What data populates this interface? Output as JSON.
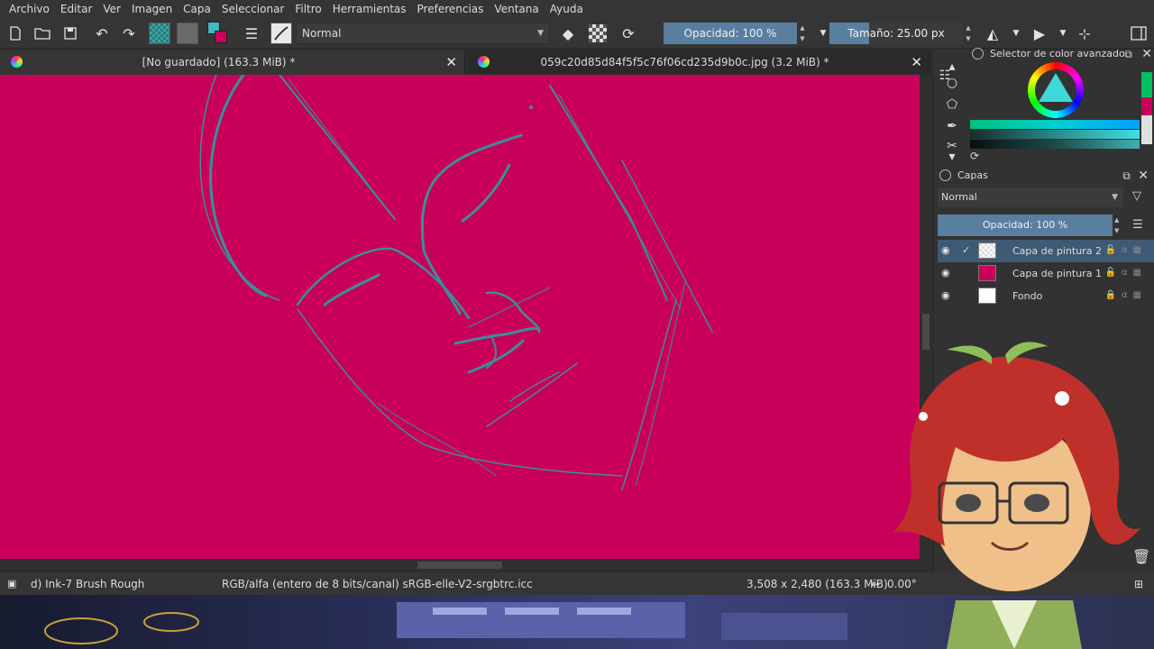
{
  "menu": [
    "Archivo",
    "Editar",
    "Ver",
    "Imagen",
    "Capa",
    "Seleccionar",
    "Filtro",
    "Herramientas",
    "Preferencias",
    "Ventana",
    "Ayuda"
  ],
  "toolbar": {
    "blend_mode": "Normal",
    "opacity_label": "Opacidad: 100 %",
    "size_label": "Tamaño: 25.00 px"
  },
  "tabs": [
    {
      "title": "[No guardado]  (163.3 MiB) *"
    },
    {
      "title": "059c20d85d84f5f5c76f06cd235d9b0c.jpg (3.2 MiB) *"
    }
  ],
  "status": {
    "brush": "d) Ink-7 Brush Rough",
    "color_space": "RGB/alfa (entero de 8 bits/canal)  sRGB-elle-V2-srgbtrc.icc",
    "dimensions": "3,508 x 2,480 (163.3 MiB)",
    "rotation": "0.00°"
  },
  "color_panel": {
    "title": "Selector de color avanzado"
  },
  "layers_panel": {
    "title": "Capas",
    "blend_mode": "Normal",
    "opacity_label": "Opacidad: 100 %",
    "layers": [
      {
        "name": "Capa de pintura 2",
        "selected": true
      },
      {
        "name": "Capa de pintura 1",
        "selected": false
      },
      {
        "name": "Fondo",
        "selected": false
      }
    ]
  },
  "colors": {
    "canvas_bg": "#c8005a",
    "sketch_line": "#3a8f9a",
    "accent_blue": "#5a7ea0"
  }
}
